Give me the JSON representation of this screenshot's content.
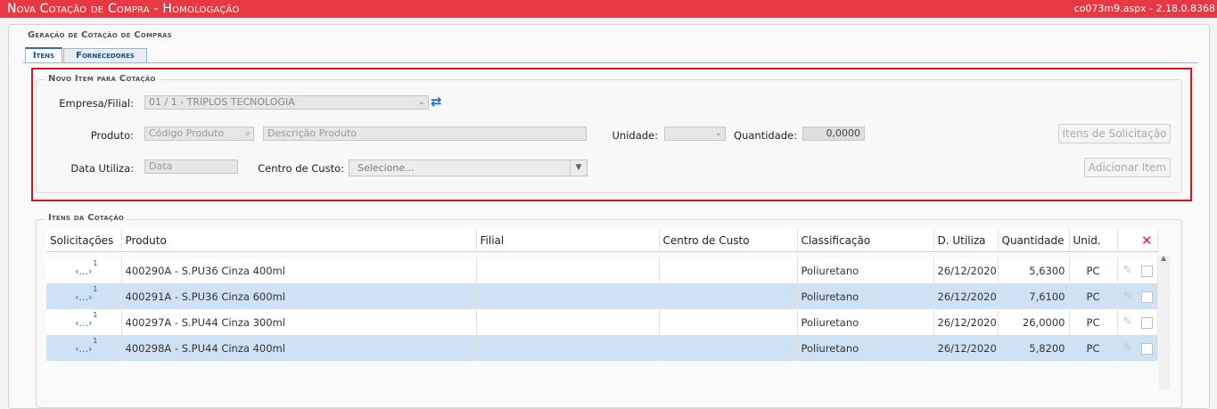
{
  "header": {
    "title": "Nova Cotação de Compra  - Homologação",
    "version": "co073m9.aspx - 2.18.0.8368"
  },
  "main_legend": "Geração de Cotação de Compras",
  "tabs": [
    "Itens",
    "Fornecedores"
  ],
  "novo_item": {
    "legend": "Novo Item para Cotação",
    "empresa_label": "Empresa/Filial:",
    "empresa_value": "01 / 1 - TRIPLOS TECNOLOGIA",
    "produto_label": "Produto:",
    "codigo_placeholder": "Código Produto",
    "descricao_placeholder": "Descrição Produto",
    "unidade_label": "Unidade:",
    "quantidade_label": "Quantidade:",
    "quantidade_value": "0,0000",
    "data_label": "Data Utiliza:",
    "data_placeholder": "Data",
    "centro_label": "Centro de Custo:",
    "centro_value": "Selecione...",
    "itens_solicitacao_button": "Itens de Solicitação",
    "adicionar_button": "Adicionar Item"
  },
  "itens_cotacao": {
    "legend": "Itens da Cotação",
    "columns": [
      "Solicitações",
      "Produto",
      "Filial",
      "Centro de Custo",
      "Classificação",
      "D. Utiliza",
      "Quantidade",
      "Unid."
    ],
    "solicitacoes_icon_text": "‹...›",
    "rows": [
      {
        "sol_count": "1",
        "produto": "400290A - S.PU36 Cinza 400ml",
        "filial": "",
        "centro": "",
        "classificacao": "Poliuretano",
        "data": "26/12/2020",
        "quantidade": "5,6300",
        "unid": "PC"
      },
      {
        "sol_count": "1",
        "produto": "400291A - S.PU36 Cinza 600ml",
        "filial": "",
        "centro": "",
        "classificacao": "Poliuretano",
        "data": "26/12/2020",
        "quantidade": "7,6100",
        "unid": "PC"
      },
      {
        "sol_count": "1",
        "produto": "400297A - S.PU44 Cinza 300ml",
        "filial": "",
        "centro": "",
        "classificacao": "Poliuretano",
        "data": "26/12/2020",
        "quantidade": "26,0000",
        "unid": "PC"
      },
      {
        "sol_count": "1",
        "produto": "400298A - S.PU44 Cinza 400ml",
        "filial": "",
        "centro": "",
        "classificacao": "Poliuretano",
        "data": "26/12/2020",
        "quantidade": "5,8200",
        "unid": "PC"
      }
    ]
  },
  "icons": {
    "search": "search-icon",
    "refresh": "refresh-icon",
    "dropdown": "chevron-down-icon",
    "delete_all": "close-icon",
    "edit": "pencil-icon"
  },
  "colors": {
    "header_bg": "#e73944",
    "highlight_border": "#d9141c",
    "alt_row": "#cfe2f3",
    "delete_icon": "#e31b23"
  }
}
